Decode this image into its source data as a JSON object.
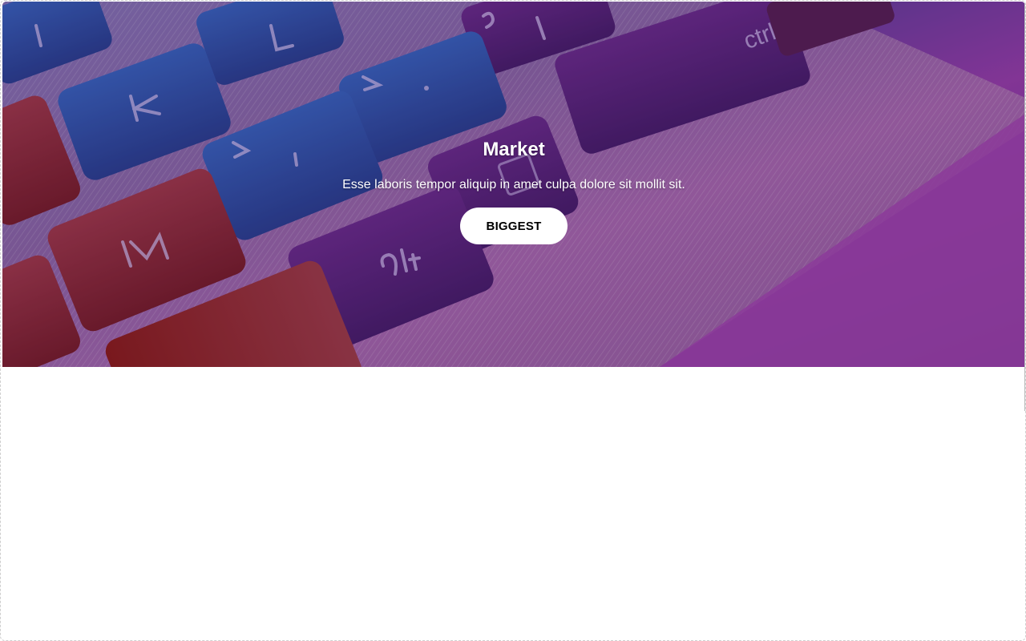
{
  "hero": {
    "title": "Market",
    "subtitle": "Esse laboris tempor aliquip in amet culpa dolore sit mollit sit.",
    "button_label": "BIGGEST",
    "background_image": "keyboard-photo",
    "keycaps": [
      "I",
      "L",
      "?",
      "/",
      "ctrl",
      "K",
      ">",
      ".",
      "<",
      ",",
      "M",
      "alt"
    ]
  },
  "colors": {
    "hero_gradient_left": "#7e1e2a",
    "hero_gradient_mid": "#6a3aa6",
    "hero_gradient_right": "#b04db6",
    "button_bg": "#ffffff",
    "button_text": "#000000",
    "title_text": "#ffffff"
  }
}
